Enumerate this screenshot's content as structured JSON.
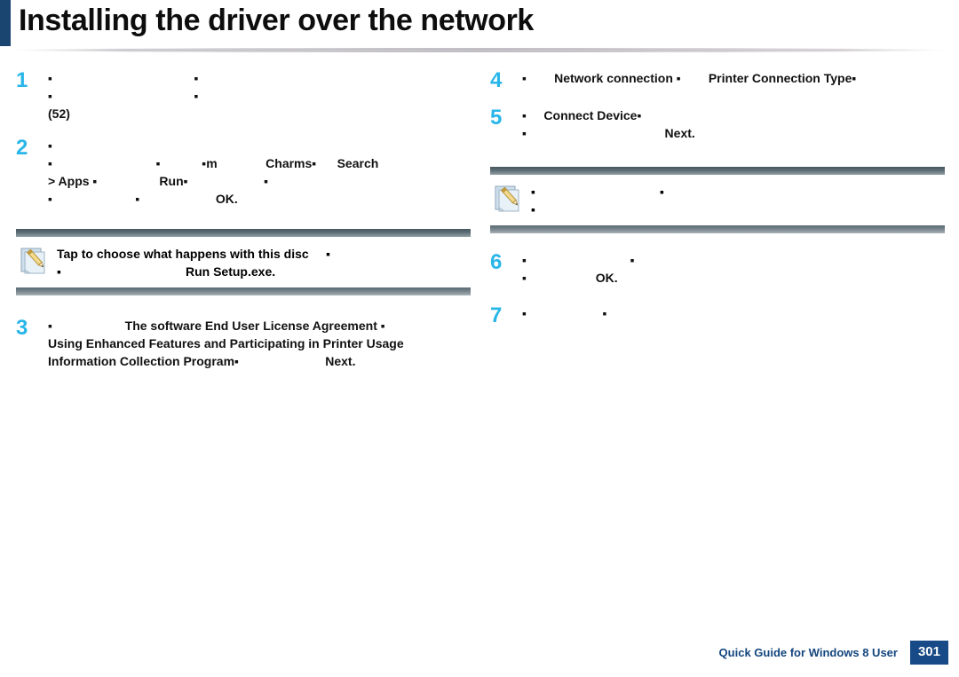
{
  "header": {
    "title": "Installing the driver over the network",
    "accent_color": "#1b4571"
  },
  "colors": {
    "step_number": "#29b6e8",
    "footer_text": "#14467e",
    "page_badge_bg": "#174a86",
    "note_bar_dark": "#47575f"
  },
  "left_column": {
    "steps": [
      {
        "number": "1",
        "lines": [
          {
            "text": "▪                                         ▪",
            "bold": true
          },
          {
            "text": "▪                                         ▪",
            "bold": true
          },
          {
            "text": "(52)",
            "bold": true
          }
        ]
      },
      {
        "number": "2",
        "lines": [
          {
            "text": "▪",
            "bold": true
          },
          {
            "text": "▪                              ▪            ▪m              Charms▪      Search",
            "bold": true
          },
          {
            "text": "> Apps ▪                  Run▪                      ▪",
            "bold": true
          },
          {
            "text": "▪                        ▪                      OK.",
            "bold": true
          }
        ]
      },
      {
        "number": "3",
        "lines": [
          {
            "text": "▪                     The software End User License Agreement ▪",
            "bold": true
          },
          {
            "text": "Using Enhanced Features and Participating in Printer Usage",
            "bold": true
          },
          {
            "text": "Information Collection Program▪                         Next.",
            "bold": true
          }
        ]
      }
    ],
    "note": {
      "icon": "note-pencil-icon",
      "lines": [
        "Tap to choose what happens with this disc     ▪",
        "▪                                    Run Setup.exe."
      ]
    }
  },
  "right_column": {
    "steps": [
      {
        "number": "4",
        "lines": [
          {
            "text": "▪        Network connection ▪        Printer Connection Type▪",
            "bold": true
          }
        ]
      },
      {
        "number": "5",
        "lines": [
          {
            "text": "▪     Connect Device▪",
            "bold": true
          },
          {
            "text": "▪                                        Next.",
            "bold": true
          }
        ]
      },
      {
        "number": "6",
        "lines": [
          {
            "text": "▪                              ▪",
            "bold": true
          },
          {
            "text": "▪                    OK.",
            "bold": true
          }
        ]
      },
      {
        "number": "7",
        "lines": [
          {
            "text": "▪                      ▪",
            "bold": true
          }
        ]
      }
    ],
    "note": {
      "icon": "note-pencil-icon",
      "lines": [
        "▪                                    ▪",
        "▪"
      ]
    }
  },
  "footer": {
    "label": "Quick Guide for Windows 8 User",
    "page_number": "301"
  }
}
